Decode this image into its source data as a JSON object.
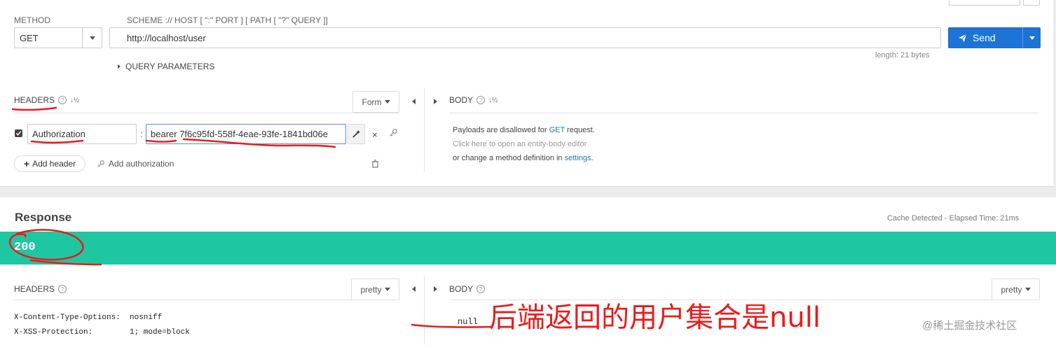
{
  "request": {
    "method_label": "METHOD",
    "method_value": "GET",
    "scheme_label": "SCHEME :// HOST [ \":\" PORT ] [ PATH [ \"?\" QUERY ]]",
    "url": "http://localhost/user",
    "length_text": "length: 21 bytes",
    "send_label": "Send",
    "query_params_label": "QUERY PARAMETERS"
  },
  "headers": {
    "title": "HEADERS",
    "mode": "Form",
    "rows": [
      {
        "key": "Authorization",
        "value": "bearer 7f6c95fd-558f-4eae-93fe-1841bd06e",
        "separator": ":"
      }
    ],
    "add_header_label": "Add header",
    "add_auth_label": "Add authorization"
  },
  "body": {
    "title": "BODY",
    "line1_pre": "Payloads are disallowed for ",
    "line1_method": "GET",
    "line1_post": " request.",
    "line2": "Click here to open an entity-body editor",
    "line3_pre": "or change a method definition in ",
    "line3_link": "settings",
    "line3_post": "."
  },
  "response": {
    "title": "Response",
    "cache_text": "Cache Detected - Elapsed Time: 21ms",
    "status": "200",
    "status_color": "#1ec7a2",
    "headers_title": "HEADERS",
    "headers_mode": "pretty",
    "header_lines": [
      {
        "key": "X-Content-Type-Options:",
        "value": "nosniff"
      },
      {
        "key": "X-XSS-Protection:",
        "value": "1; mode=block"
      }
    ],
    "body_title": "BODY",
    "body_mode": "pretty",
    "body_value": "null"
  },
  "annotation": {
    "text": "后端返回的用户集合是null",
    "color": "#e81c1c"
  },
  "watermark": "@稀土掘金技术社区"
}
